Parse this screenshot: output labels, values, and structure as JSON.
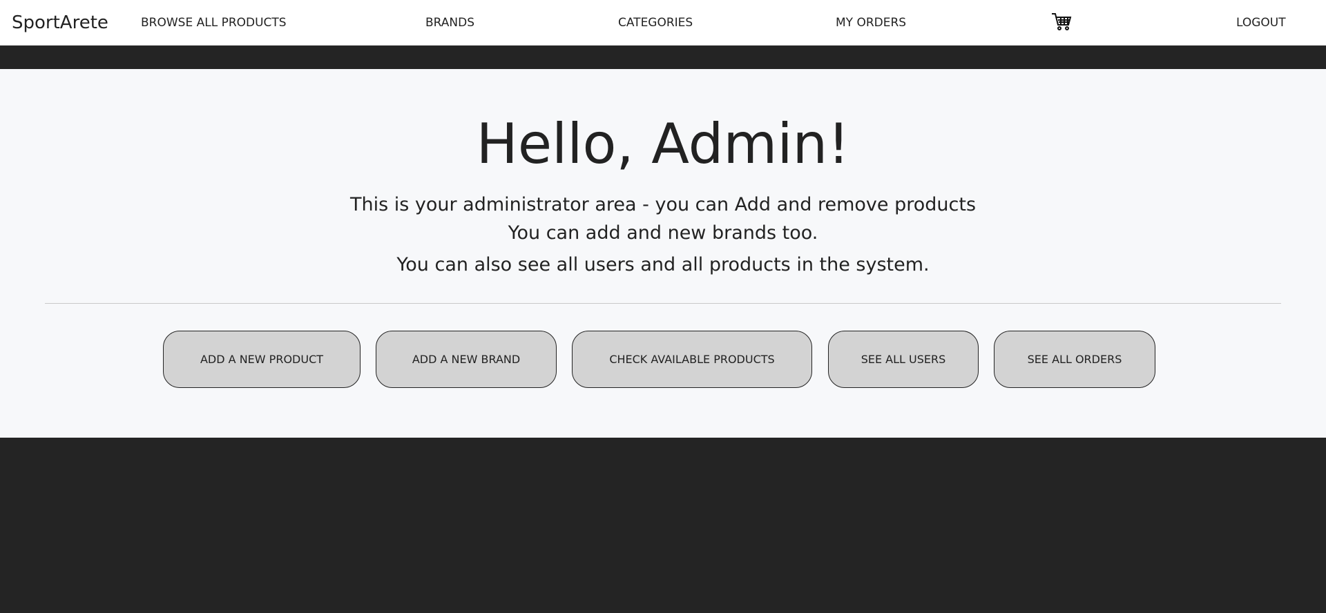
{
  "nav": {
    "logo": "SportArete",
    "browse": "BROWSE ALL PRODUCTS",
    "brands": "BRANDS",
    "categories": "CATEGORIES",
    "orders": "MY ORDERS",
    "cart_icon": "shopping-cart-icon",
    "logout": "LOGOUT"
  },
  "hero": {
    "title": "Hello, Admin!",
    "line1": "This is your administrator area - you can Add and remove products",
    "line2": "You can add and new brands too.",
    "line3": "You can also see all users and all products in the system."
  },
  "buttons": {
    "add_product": "ADD A NEW PRODUCT",
    "add_brand": "ADD A NEW BRAND",
    "check_products": "CHECK AVAILABLE PRODUCTS",
    "see_users": "SEE ALL USERS",
    "see_orders": "SEE ALL ORDERS"
  }
}
